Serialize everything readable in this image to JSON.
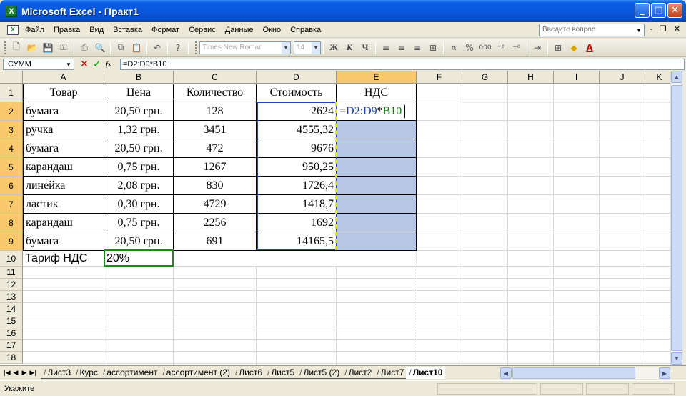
{
  "window": {
    "title": "Microsoft Excel - Практ1",
    "app_icon": "excel-icon"
  },
  "menu": {
    "items": [
      "Файл",
      "Правка",
      "Вид",
      "Вставка",
      "Формат",
      "Сервис",
      "Данные",
      "Окно",
      "Справка"
    ],
    "help_placeholder": "Введите вопрос"
  },
  "toolbar": {
    "font_name": "Times New Roman",
    "font_size": "14",
    "bold": "Ж",
    "italic": "К",
    "underline": "Ч",
    "percent": "%",
    "thousands": "000"
  },
  "formula_bar": {
    "name_box": "СУММ",
    "fx": "fx",
    "formula": "=D2:D9*B10"
  },
  "columns": [
    "A",
    "B",
    "C",
    "D",
    "E",
    "F",
    "G",
    "H",
    "I",
    "J",
    "K"
  ],
  "rows": [
    "1",
    "2",
    "3",
    "4",
    "5",
    "6",
    "7",
    "8",
    "9",
    "10",
    "11",
    "12",
    "13",
    "14",
    "15",
    "16",
    "17",
    "18"
  ],
  "table": {
    "headers": [
      "Товар",
      "Цена",
      "Количество",
      "Стоимость",
      "НДС"
    ],
    "data": [
      [
        "бумага",
        "20,50 грн.",
        "128",
        "2624"
      ],
      [
        "ручка",
        "1,32 грн.",
        "3451",
        "4555,32"
      ],
      [
        "бумага",
        "20,50 грн.",
        "472",
        "9676"
      ],
      [
        "карандаш",
        "0,75 грн.",
        "1267",
        "950,25"
      ],
      [
        "линейка",
        "2,08 грн.",
        "830",
        "1726,4"
      ],
      [
        "ластик",
        "0,30 грн.",
        "4729",
        "1418,7"
      ],
      [
        "карандаш",
        "0,75 грн.",
        "2256",
        "1692"
      ],
      [
        "бумага",
        "20,50 грн.",
        "691",
        "14165,5"
      ]
    ],
    "editing_cell": {
      "eq": "=",
      "ref1": "D2:D9",
      "op": "*",
      "ref2": "B10"
    },
    "tariff_label": "Тариф НДС",
    "tariff_value": "20%"
  },
  "sheet_tabs": [
    "Лист3",
    "Курс",
    "ассортимент",
    "ассортимент (2)",
    "Лист6",
    "Лист5",
    "Лист5 (2)",
    "Лист2",
    "Лист7",
    "Лист10"
  ],
  "active_tab": "Лист10",
  "status": "Укажите"
}
